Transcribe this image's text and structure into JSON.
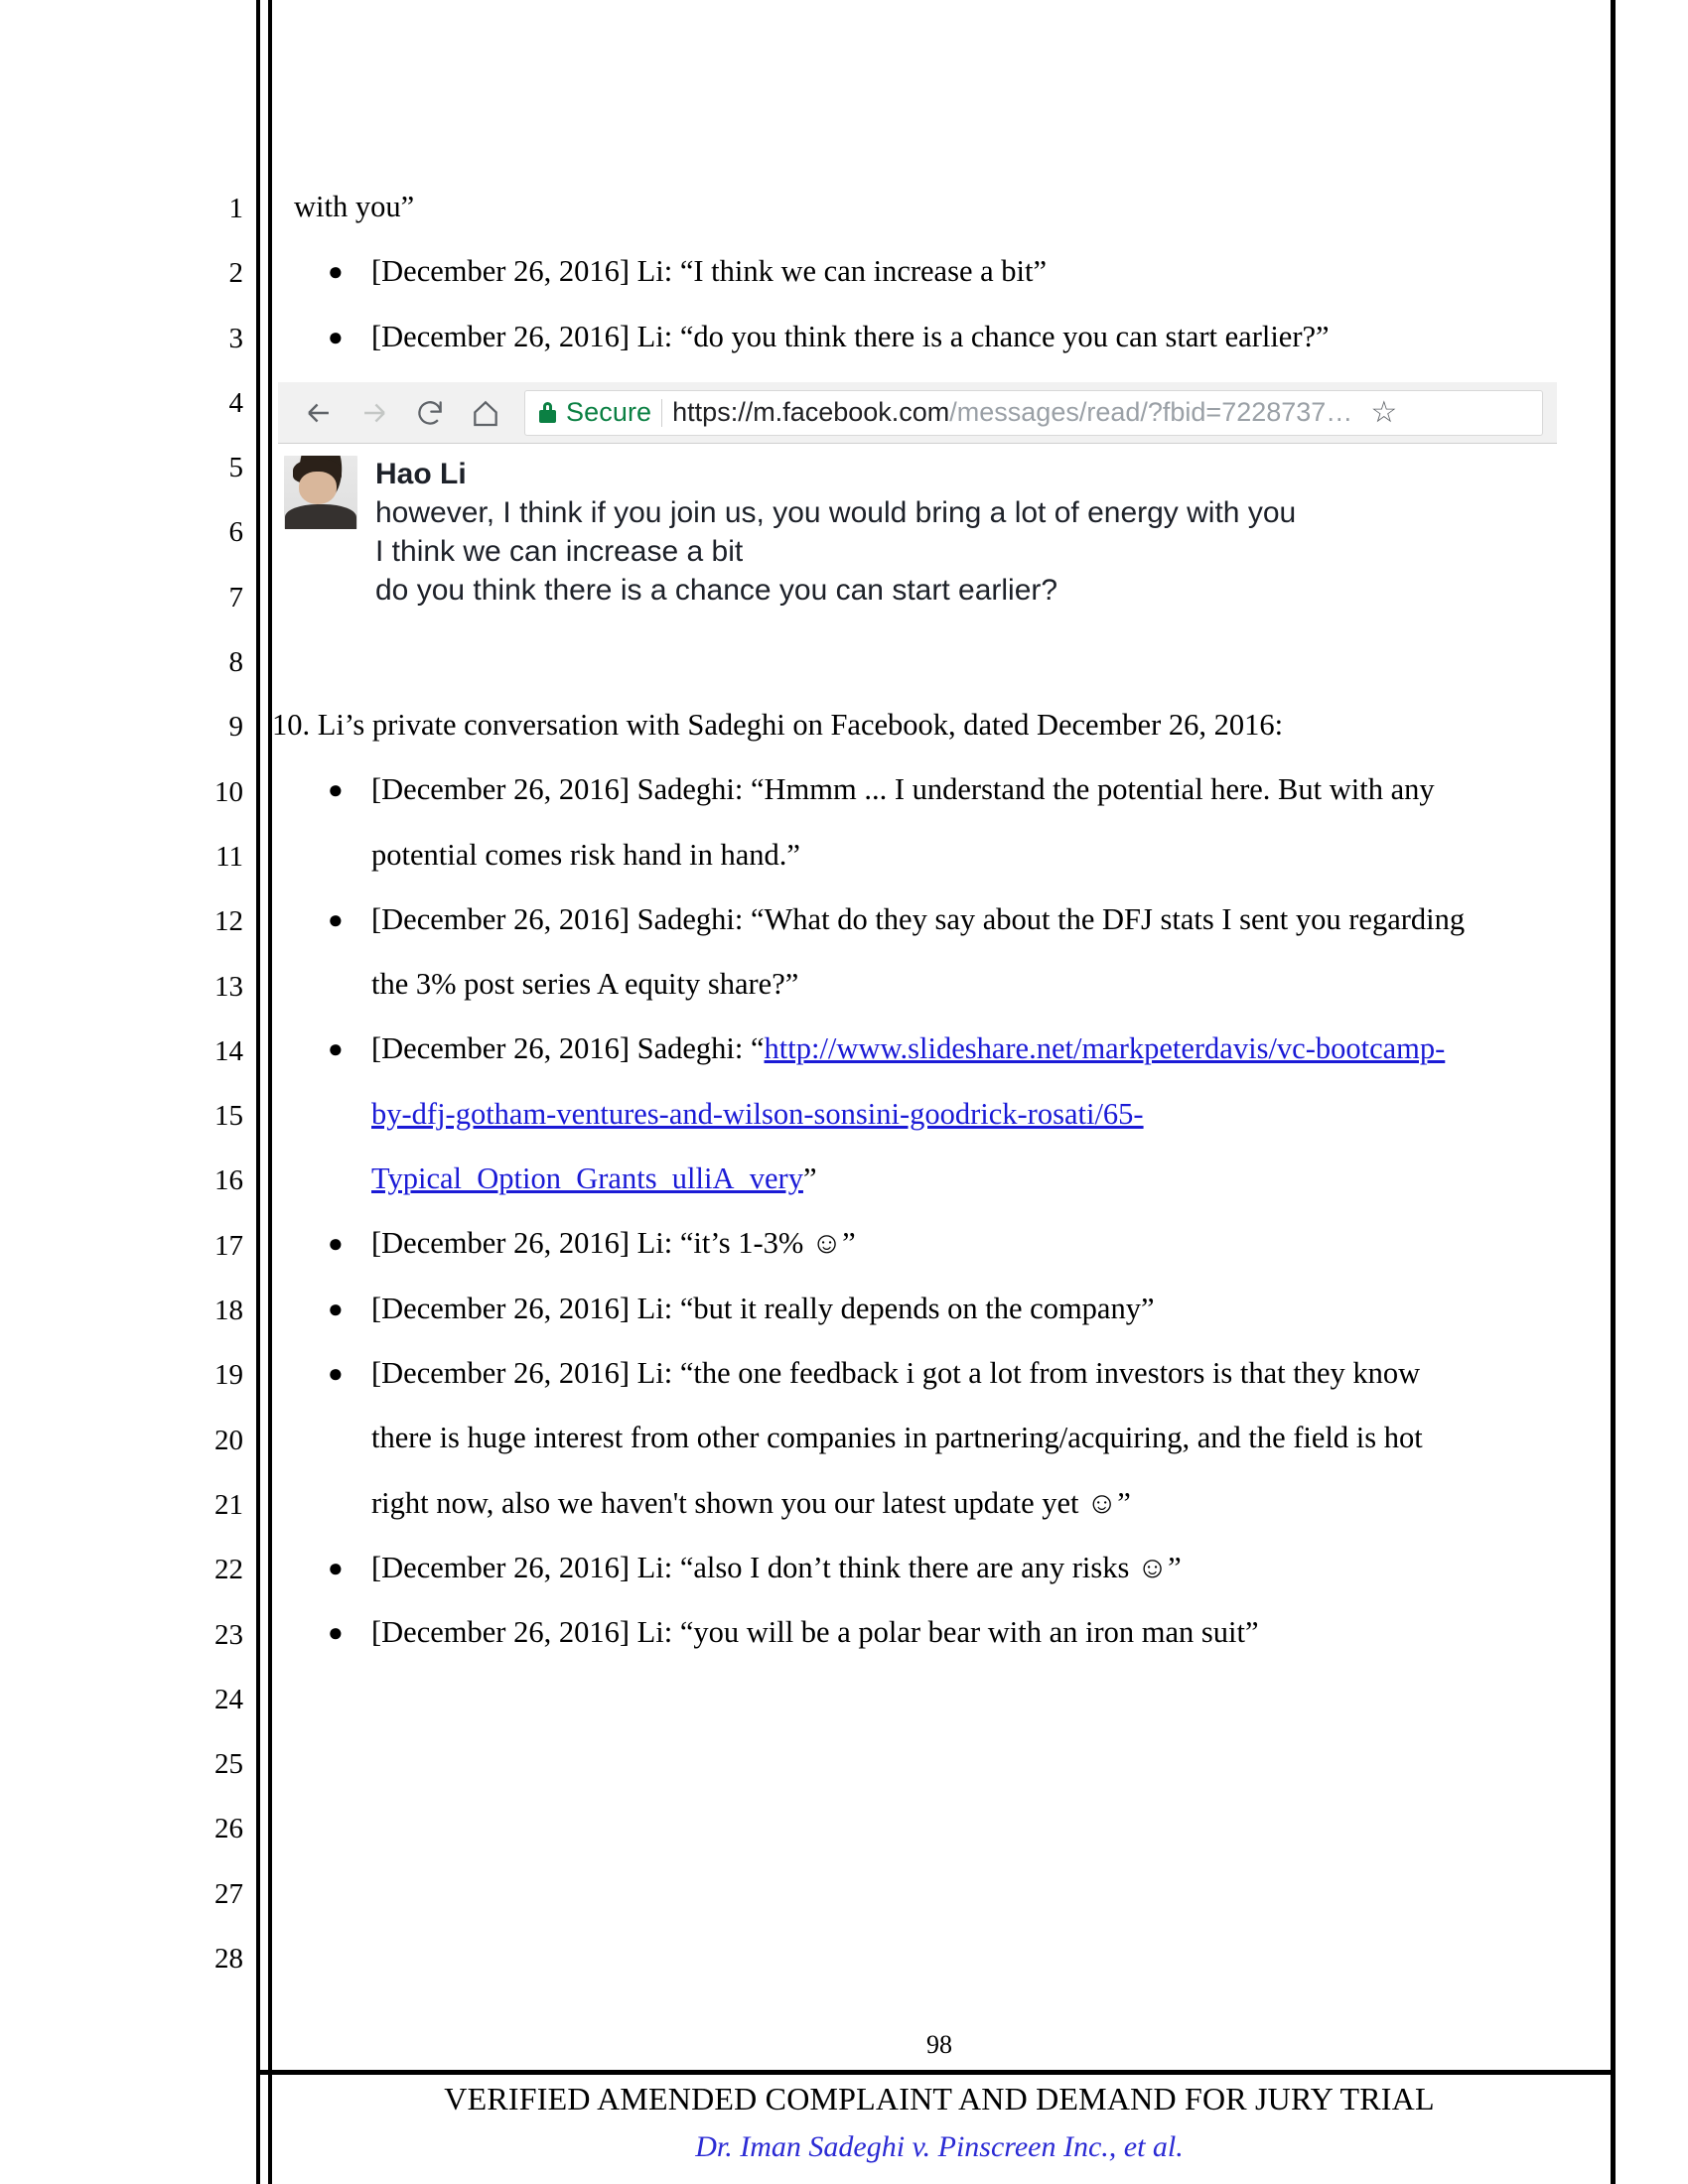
{
  "document": {
    "line_numbers": [
      "1",
      "2",
      "3",
      "4",
      "5",
      "6",
      "7",
      "8",
      "9",
      "10",
      "11",
      "12",
      "13",
      "14",
      "15",
      "16",
      "17",
      "18",
      "19",
      "20",
      "21",
      "22",
      "23",
      "24",
      "25",
      "26",
      "27",
      "28"
    ],
    "continuation_text": "with you”",
    "top_bullets": [
      "[December 26, 2016] Li: “I think we can increase a bit”",
      "[December 26, 2016] Li: “do you think there is a chance you can start earlier?”"
    ],
    "paragraph_10": "10. Li’s private conversation with Sadeghi on Facebook, dated December 26, 2016:",
    "bullets": [
      {
        "lines": [
          "[December 26, 2016] Sadeghi: “Hmmm ... I understand the potential here. But with any",
          "potential comes risk hand in hand.”"
        ]
      },
      {
        "lines": [
          "[December 26, 2016] Sadeghi: “What do they say about the DFJ stats I sent you regarding",
          "the 3% post series A equity share?”"
        ]
      },
      {
        "link": true,
        "prefix": "[December 26, 2016] Sadeghi: “",
        "link_lines": [
          "http://www.slideshare.net/markpeterdavis/vc-bootcamp-",
          "by-dfj-gotham-ventures-and-wilson-sonsini-goodrick-rosati/65-",
          "Typical_Option_Grants_ulliA_very"
        ],
        "suffix": "”"
      },
      {
        "lines": [
          "[December 26, 2016] Li: “it’s 1-3% ☺”"
        ]
      },
      {
        "lines": [
          "[December 26, 2016] Li: “but it really depends on the company”"
        ]
      },
      {
        "lines": [
          "[December 26, 2016] Li: “the one feedback i got a lot from investors is that they know",
          "there is huge interest from other companies in partnering/acquiring, and the field is hot",
          "right now, also we haven't shown you our latest update yet ☺”"
        ]
      },
      {
        "lines": [
          "[December 26, 2016] Li: “also I don’t think there are any risks ☺”"
        ]
      },
      {
        "lines": [
          "[December 26, 2016] Li: “you will be a polar bear with an iron man suit”"
        ]
      }
    ]
  },
  "browser_screenshot": {
    "back_icon": "arrow-left-icon",
    "forward_icon": "arrow-right-icon",
    "reload_icon": "reload-icon",
    "home_icon": "home-icon",
    "lock_icon": "lock-icon",
    "security_label": "Secure",
    "url_host": "https://m.facebook.com",
    "url_path": "/messages/read/?fbid=7228737…",
    "bookmark_icon": "star-icon",
    "conversation": {
      "avatar": "user-avatar",
      "sender": "Hao Li",
      "messages": [
        "however, I think if you join us, you would bring a lot of energy with you",
        "I think we can increase a bit",
        "do you think there is a chance you can start earlier?"
      ]
    }
  },
  "footer": {
    "page_number": "98",
    "title": "VERIFIED AMENDED COMPLAINT AND DEMAND FOR JURY TRIAL",
    "case_caption": "Dr. Iman Sadeghi v. Pinscreen Inc., et al."
  },
  "colors": {
    "link": "#1a1ad6",
    "case_caption": "#2b2bd4",
    "secure_green": "#0b8043"
  }
}
